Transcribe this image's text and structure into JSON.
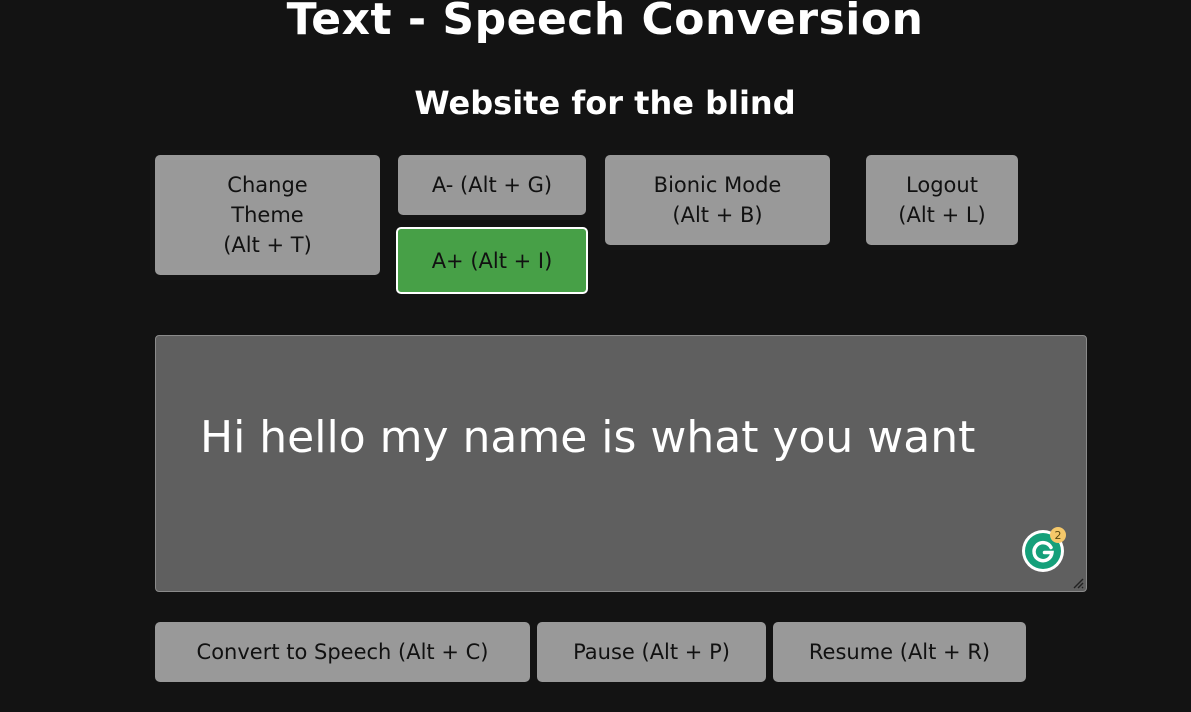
{
  "header": {
    "title": "Text - Speech Conversion",
    "subtitle": "Website for the blind"
  },
  "toolbar": {
    "change_theme": "Change\nTheme\n(Alt + T)",
    "decrease_font": "A- (Alt + G)",
    "increase_font": "A+ (Alt + I)",
    "bionic_mode": "Bionic Mode\n(Alt + B)",
    "logout": "Logout\n(Alt + L)"
  },
  "editor": {
    "text": "Hi hello my name is what you want",
    "grammarly_badge": "2"
  },
  "controls": {
    "convert": "Convert to Speech (Alt + C)",
    "pause": "Pause (Alt + P)",
    "resume": "Resume (Alt + R)"
  },
  "colors": {
    "background": "#131313",
    "button": "#999999",
    "active_button": "#47a047",
    "editor_background": "#5f5f5f",
    "grammarly_green": "#15a07a",
    "grammarly_badge": "#f5c86a"
  },
  "icons": {
    "grammarly": "grammarly-icon",
    "resize": "resize-handle-icon"
  }
}
